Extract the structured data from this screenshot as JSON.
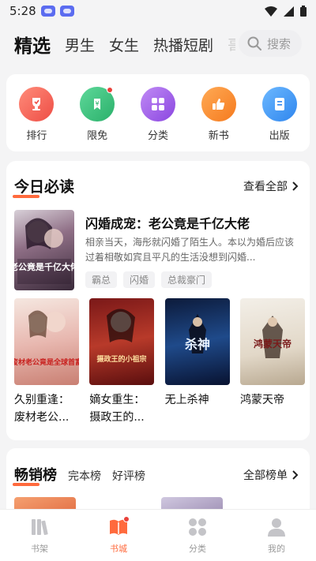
{
  "status_bar": {
    "time": "5:28"
  },
  "top_tabs": {
    "items": [
      "精选",
      "男生",
      "女生",
      "热播短剧",
      "哥"
    ],
    "search_placeholder": "搜索"
  },
  "categories": [
    {
      "label": "排行",
      "icon": "trophy-icon",
      "color": "#f26b5b"
    },
    {
      "label": "限免",
      "icon": "price-tag-icon",
      "color": "#3cc47c"
    },
    {
      "label": "分类",
      "icon": "grid-icon",
      "color": "#9b59e0"
    },
    {
      "label": "新书",
      "icon": "thumbs-up-icon",
      "color": "#f5862b"
    },
    {
      "label": "出版",
      "icon": "book-icon",
      "color": "#3e9ef5"
    }
  ],
  "today": {
    "title": "今日必读",
    "see_all": "查看全部",
    "feature": {
      "title": "闪婚成宠：老公竟是千亿大佬",
      "desc": "相亲当天，海彤就闪婚了陌生人。本以为婚后应该过着相敬如宾且平凡的生活没想到闪婚...",
      "tags": [
        "霸总",
        "闪婚",
        "总裁豪门"
      ],
      "cover_text": "老公竟是千亿大佬"
    },
    "books": [
      {
        "title": "久别重逢：废材老公...",
        "cover_text": "废材老公竟是全球首富"
      },
      {
        "title": "嫡女重生：摄政王的...",
        "cover_text": "摄政王的小祖宗"
      },
      {
        "title": "无上杀神",
        "cover_text": "杀神"
      },
      {
        "title": "鸿蒙天帝",
        "cover_text": "鸿蒙天帝"
      }
    ]
  },
  "bestseller": {
    "title": "畅销榜",
    "tabs": [
      "完本榜",
      "好评榜"
    ],
    "see_all": "全部榜单"
  },
  "bottom_nav": [
    {
      "label": "书架",
      "icon": "bookshelf-icon",
      "active": false
    },
    {
      "label": "书城",
      "icon": "bookstore-icon",
      "active": true
    },
    {
      "label": "分类",
      "icon": "category-icon",
      "active": false
    },
    {
      "label": "我的",
      "icon": "profile-icon",
      "active": false
    }
  ],
  "colors": {
    "accent": "#ff6a3d",
    "background": "#f4f4f5"
  }
}
